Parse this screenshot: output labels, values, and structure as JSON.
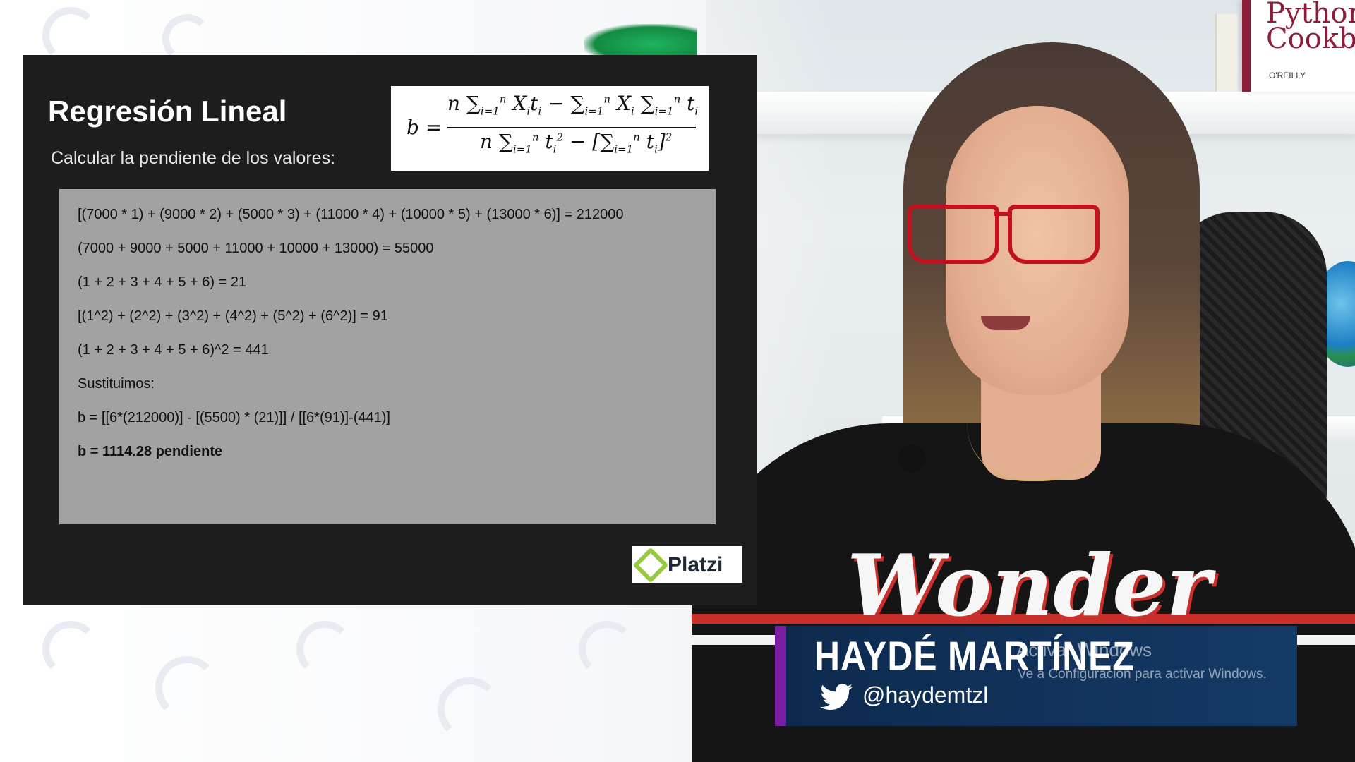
{
  "slide": {
    "title": "Regresión Lineal",
    "subtitle": "Calcular la pendiente de los valores:",
    "formula_lhs": "b =",
    "lines": [
      "[(7000 * 1) + (9000 * 2) + (5000 * 3) + (11000 * 4) + (10000 * 5) + (13000 * 6)] = 212000",
      "(7000 + 9000 + 5000 + 11000 + 10000 + 13000) = 55000",
      "(1 + 2 + 3 + 4 + 5 + 6) = 21",
      "[(1^2) + (2^2) + (3^2) + (4^2) + (5^2) + (6^2)] = 91",
      "(1 + 2 + 3 + 4 + 5 + 6)^2 = 441",
      "Sustituimos:",
      " b = [[6*(212000)] - [(5500) * (21)]] /  [[6*(91)]-(441)]",
      " b = 1114.28 pendiente"
    ],
    "logo": "Platzi"
  },
  "presenter": {
    "name": "HAYDÉ MARTÍNEZ",
    "handle": "@haydemtzl"
  },
  "windows_watermark": {
    "title": "Activar Windows",
    "subtitle": "Ve a Configuración para activar Windows."
  },
  "background": {
    "book_title_line1": "Python",
    "book_title_line2": "Cookbo",
    "book_publisher": "O'REILLY",
    "shirt_text": "Wonder"
  },
  "colors": {
    "slide_bg": "#1d1d1d",
    "workbox_bg": "#a2a2a2",
    "lower_third_bg": "#0d2a4e",
    "lower_third_accent": "#7b1fa2",
    "platzi_green": "#98ca3f"
  }
}
